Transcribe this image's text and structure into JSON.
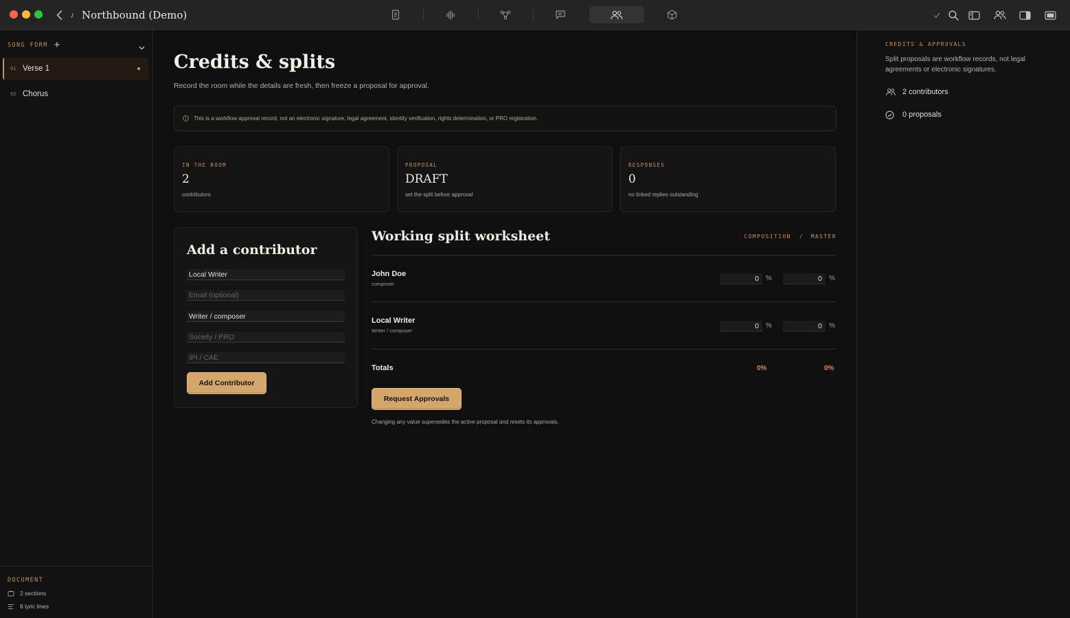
{
  "window": {
    "title": "Northbound (Demo)"
  },
  "sidebar": {
    "header": "SONG FORM",
    "sections": [
      {
        "num": "01",
        "name": "Verse 1"
      },
      {
        "num": "02",
        "name": "Chorus"
      }
    ],
    "footer": {
      "label": "DOCUMENT",
      "sections_count": "2 sections",
      "lyric_lines": "8 lyric lines"
    }
  },
  "main": {
    "title": "Credits & splits",
    "subtitle": "Record the room while the details are fresh, then freeze a proposal for approval.",
    "notice": "This is a workflow approval record, not an electronic signature, legal agreement, identity verification, rights determination, or PRO registration.",
    "stats": [
      {
        "label": "IN THE ROOM",
        "value": "2",
        "note": "contributors"
      },
      {
        "label": "PROPOSAL",
        "value": "DRAFT",
        "note": "set the split before approval"
      },
      {
        "label": "RESPONSES",
        "value": "0",
        "note": "no linked replies outstanding"
      }
    ],
    "add_contributor": {
      "title": "Add a contributor",
      "name_value": "Local Writer",
      "email_placeholder": "Email (optional)",
      "role_value": "Writer / composer",
      "society_placeholder": "Society / PRO",
      "ipi_placeholder": "IPI / CAE",
      "button": "Add Contributor"
    },
    "worksheet": {
      "title": "Working split worksheet",
      "col_composition": "COMPOSITION",
      "col_separator": "/",
      "col_master": "MASTER",
      "rows": [
        {
          "name": "John Doe",
          "role": "composer",
          "composition": "0",
          "master": "0"
        },
        {
          "name": "Local Writer",
          "role": "Writer / composer",
          "composition": "0",
          "master": "0"
        }
      ],
      "percent_sign": "%",
      "totals_label": "Totals",
      "total_composition": "0%",
      "total_master": "0%",
      "request_button": "Request Approvals",
      "footnote": "Changing any value supersedes the active proposal and resets its approvals."
    }
  },
  "right_panel": {
    "header": "CREDITS & APPROVALS",
    "description": "Split proposals are workflow records, not legal agreements or electronic signatures.",
    "contributors": "2 contributors",
    "proposals": "0 proposals"
  },
  "colors": {
    "accent": "#c8935a",
    "button_gold": "#d5a66c",
    "total_orange": "#d88a55",
    "background": "#0f0f0f"
  }
}
